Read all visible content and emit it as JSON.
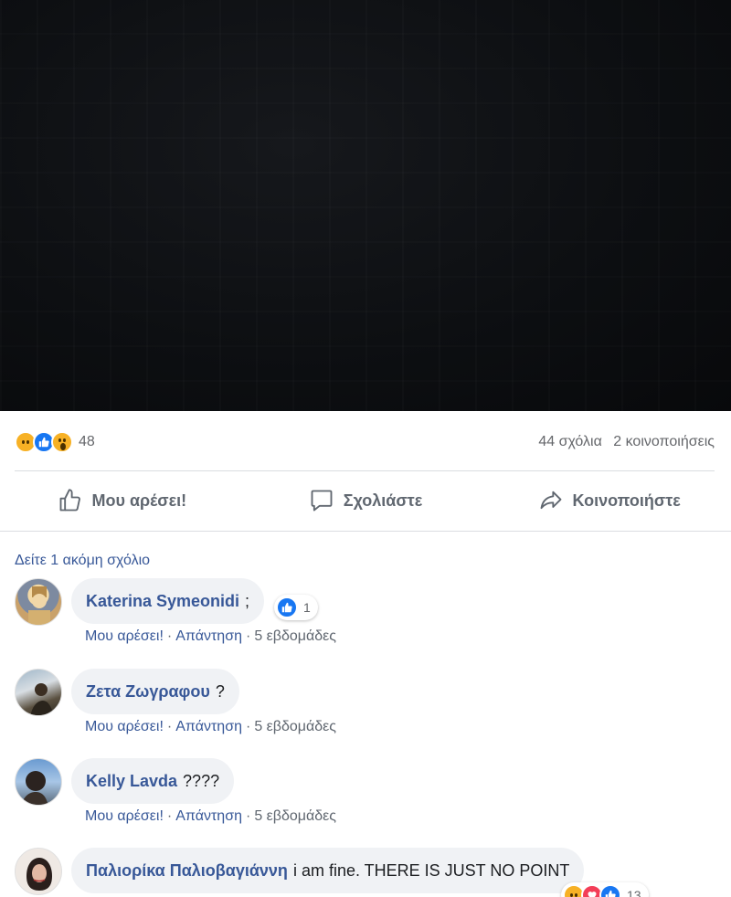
{
  "post": {
    "reactions": {
      "icons": [
        "sad-icon",
        "like-icon",
        "wow-icon"
      ],
      "count": "48"
    },
    "comments_count": "44 σχόλια",
    "shares_count": "2 κοινοποιήσεις"
  },
  "actions": {
    "like_label": "Μου αρέσει!",
    "comment_label": "Σχολιάστε",
    "share_label": "Κοινοποιήστε"
  },
  "view_more_comments": "Δείτε 1 ακόμη σχόλιο",
  "comments": [
    {
      "author": "Katerina Symeonidi",
      "text": ";",
      "like_action": "Μου αρέσει!",
      "reply_action": "Απάντηση",
      "sep": "·",
      "time": "5 εβδομάδες",
      "reaction_count": "1"
    },
    {
      "author": "Ζετα Ζωγραφου",
      "text": "?",
      "like_action": "Μου αρέσει!",
      "reply_action": "Απάντηση",
      "sep": "·",
      "time": "5 εβδομάδες"
    },
    {
      "author": "Kelly Lavda",
      "text": "????",
      "like_action": "Μου αρέσει!",
      "reply_action": "Απάντηση",
      "sep": "·",
      "time": "5 εβδομάδες"
    },
    {
      "author": "Παλιορίκα Παλιοβαγιάννη",
      "text": "i am fine. THERE IS JUST NO POINT",
      "reaction_count": "13"
    }
  ],
  "colors": {
    "link": "#385898",
    "like_blue": "#1877f2",
    "emoji_yellow": "#f7b125",
    "love_red": "#f33e58"
  }
}
